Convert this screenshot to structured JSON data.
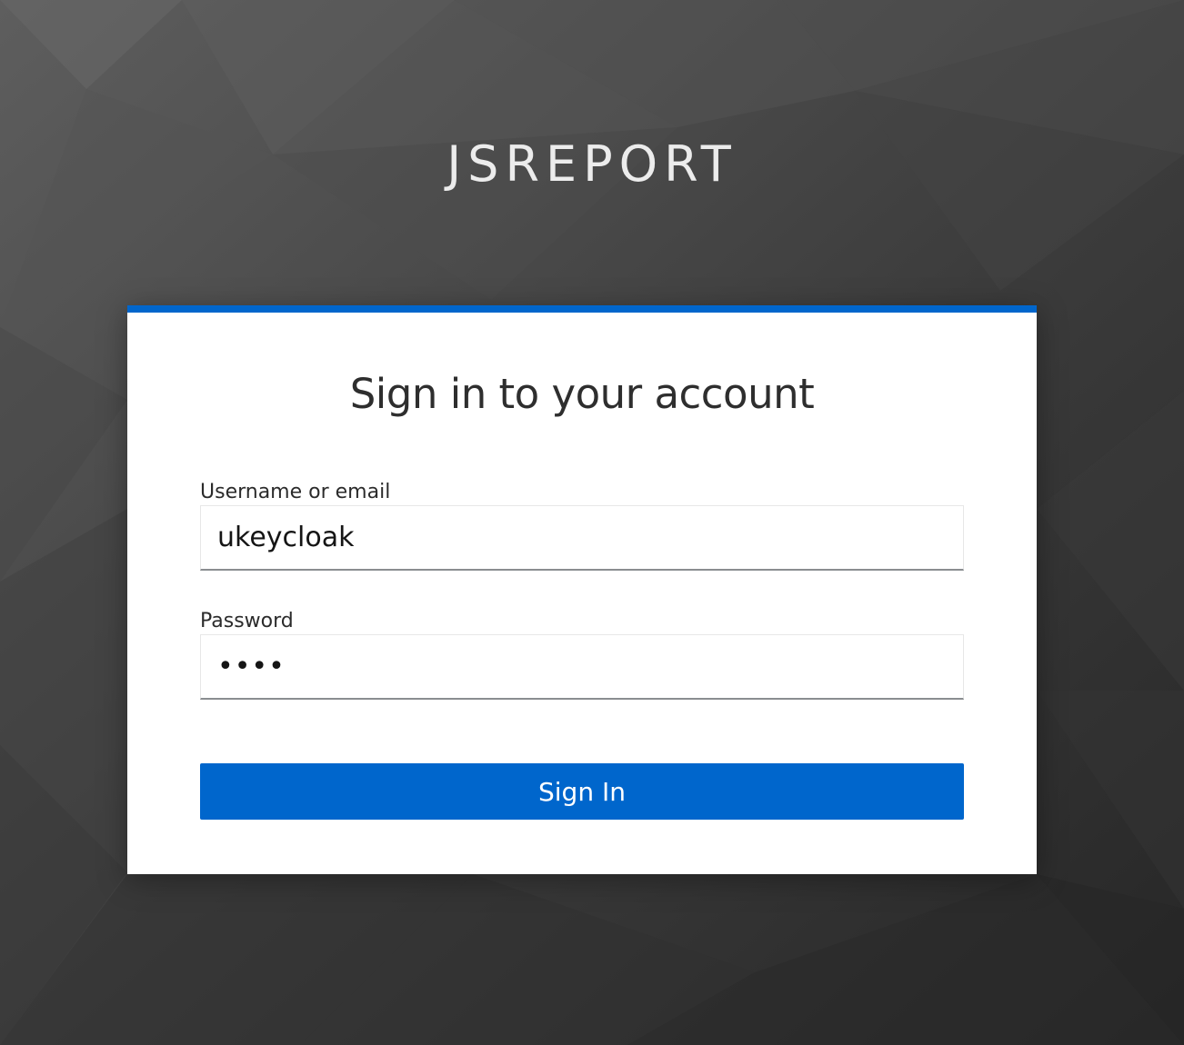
{
  "realm": {
    "title": "JSREPORT"
  },
  "login": {
    "heading": "Sign in to your account",
    "username": {
      "label": "Username or email",
      "value": "ukeycloak"
    },
    "password": {
      "label": "Password",
      "value": "1234"
    },
    "submit_label": "Sign In"
  },
  "colors": {
    "accent": "#0066cc",
    "background": "#3a3a3a"
  }
}
